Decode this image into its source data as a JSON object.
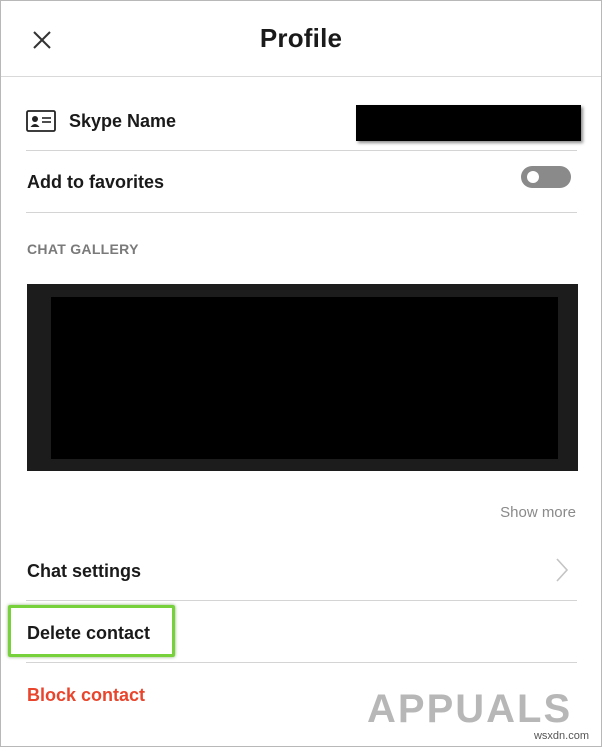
{
  "header": {
    "title": "Profile",
    "close_icon": "close-icon"
  },
  "skype_name": {
    "label": "Skype Name",
    "icon": "contact-card-icon",
    "value_redacted": true
  },
  "favorites": {
    "label": "Add to favorites",
    "toggle_on": false
  },
  "chat_gallery": {
    "header": "CHAT GALLERY",
    "show_more": "Show more"
  },
  "actions": {
    "chat_settings": "Chat settings",
    "delete_contact": "Delete contact",
    "block_contact": "Block contact"
  },
  "watermark": {
    "text": "APPUALS"
  },
  "source": "wsxdn.com",
  "colors": {
    "danger": "#e8452c",
    "highlight": "#76d13a",
    "toggle_off": "#8a8a8a",
    "muted_text": "#7a7a7a"
  }
}
